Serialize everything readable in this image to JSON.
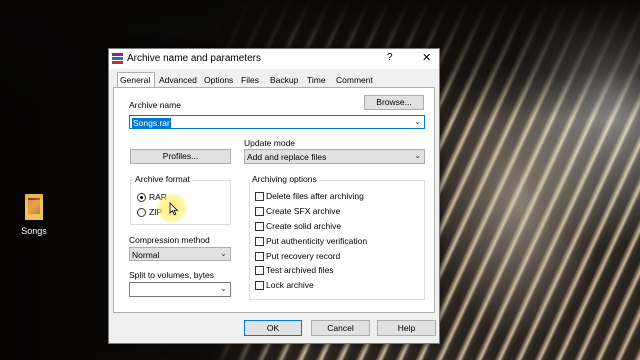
{
  "desktop": {
    "icon_label": "Songs"
  },
  "dialog": {
    "title": "Archive name and parameters",
    "help_glyph": "?",
    "close_glyph": "✕",
    "tabs": [
      {
        "label": "General"
      },
      {
        "label": "Advanced"
      },
      {
        "label": "Options"
      },
      {
        "label": "Files"
      },
      {
        "label": "Backup"
      },
      {
        "label": "Time"
      },
      {
        "label": "Comment"
      }
    ],
    "archive_name_label": "Archive name",
    "browse_label": "Browse...",
    "archive_name_value": "Songs.rar",
    "update_mode_label": "Update mode",
    "profiles_label": "Profiles...",
    "update_mode_value": "Add and replace files",
    "archive_format": {
      "title": "Archive format",
      "options": [
        {
          "label": "RAR",
          "selected": true
        },
        {
          "label": "ZIP",
          "selected": false
        }
      ]
    },
    "archiving_options": {
      "title": "Archiving options",
      "items": [
        {
          "label": "Delete files after archiving",
          "checked": false
        },
        {
          "label": "Create SFX archive",
          "checked": false
        },
        {
          "label": "Create solid archive",
          "checked": false
        },
        {
          "label": "Put authenticity verification",
          "checked": false
        },
        {
          "label": "Put recovery record",
          "checked": false
        },
        {
          "label": "Test archived files",
          "checked": false
        },
        {
          "label": "Lock archive",
          "checked": false
        }
      ]
    },
    "compression_method_label": "Compression method",
    "compression_method_value": "Normal",
    "split_label": "Split to volumes, bytes",
    "split_value": "",
    "ok_label": "OK",
    "cancel_label": "Cancel",
    "help_label": "Help",
    "chevron_glyph": "⌄"
  },
  "colors": {
    "accent": "#0078d7",
    "folder": "#e8b84a",
    "cursor_highlight": "#ffeb5a"
  }
}
